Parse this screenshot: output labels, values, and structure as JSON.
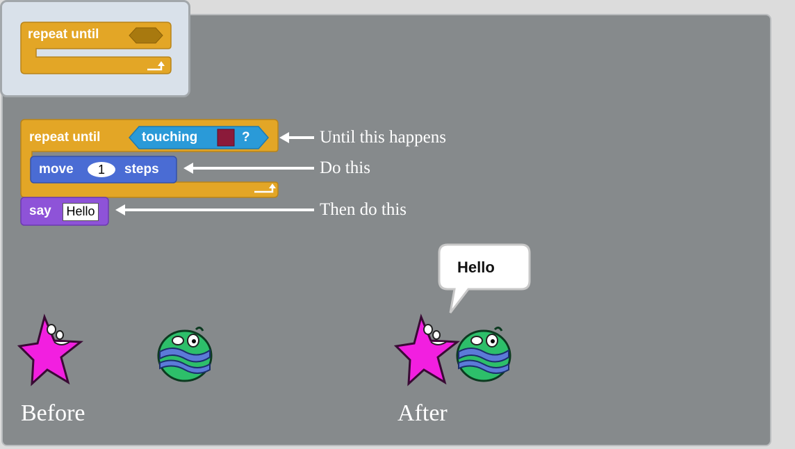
{
  "palette": {
    "repeat_until_label": "repeat until"
  },
  "script": {
    "repeat_until_label": "repeat until",
    "touching_label": "touching",
    "touching_question": "?",
    "touching_color": "#8b1a3a",
    "move_label": "move",
    "move_steps_value": "1",
    "steps_label": "steps",
    "say_label": "say",
    "say_value": "Hello"
  },
  "annotations": {
    "until": "Until this happens",
    "do": "Do this",
    "then": "Then do this"
  },
  "stage": {
    "before_caption": "Before",
    "after_caption": "After",
    "speech_text": "Hello"
  },
  "colors": {
    "control": "#e3a626",
    "sensing": "#2a9ad8",
    "motion": "#4a6cd4",
    "looks": "#8e53d8",
    "panel": "#868a8c"
  },
  "icons": {
    "starfish": "pink-starfish-sprite",
    "blob": "green-blob-sprite",
    "loop_arrow": "loop-arrow-icon"
  }
}
